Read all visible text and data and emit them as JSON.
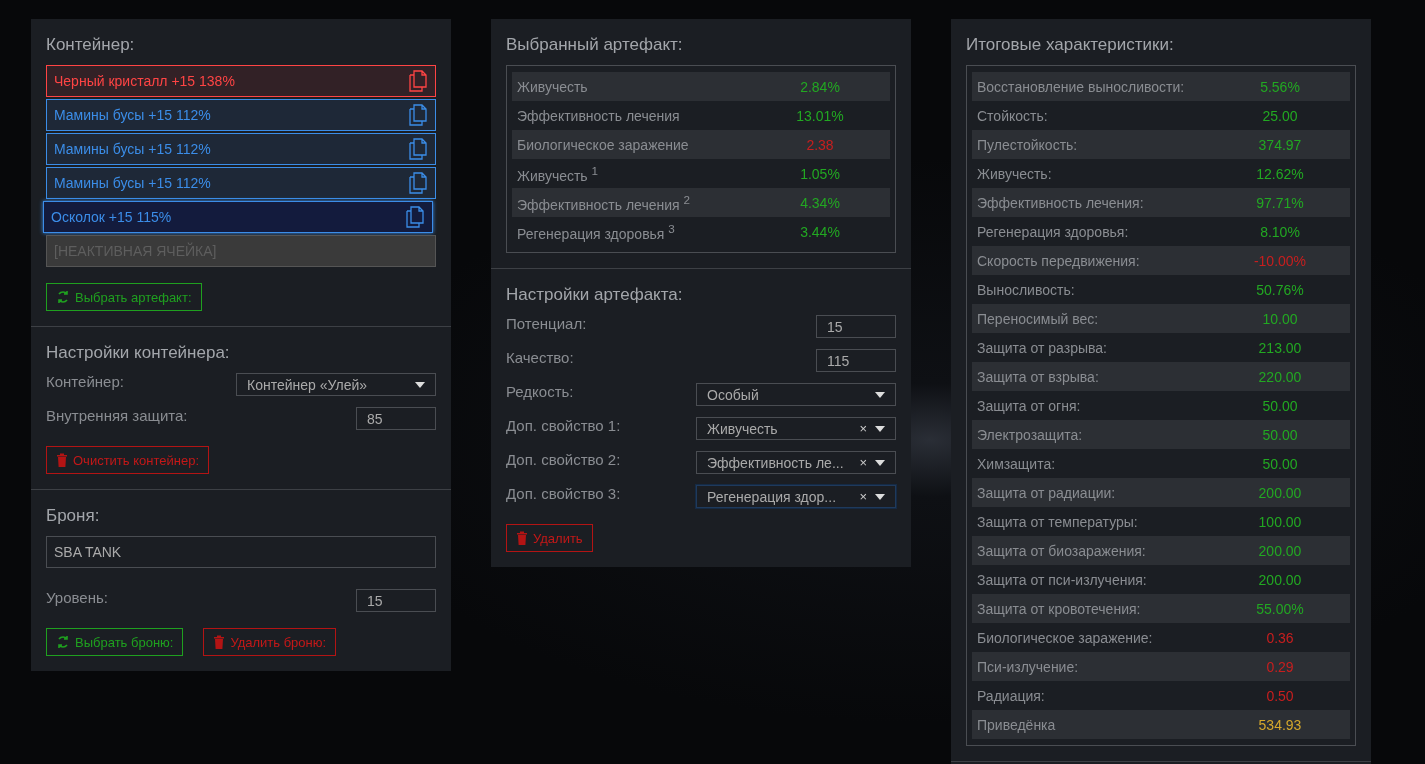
{
  "container": {
    "title": "Контейнер:",
    "slots": [
      {
        "kind": "artifact",
        "label": "Черный кристалл +15 138%",
        "color": "#ff4444",
        "selected": false
      },
      {
        "kind": "artifact",
        "label": "Мамины бусы +15 112%",
        "color": "#3b8de8",
        "selected": false
      },
      {
        "kind": "artifact",
        "label": "Мамины бусы +15 112%",
        "color": "#3b8de8",
        "selected": false
      },
      {
        "kind": "artifact",
        "label": "Мамины бусы +15 112%",
        "color": "#3b8de8",
        "selected": false
      },
      {
        "kind": "artifact",
        "label": "Осколок +15 115%",
        "color": "#3b8de8",
        "selected": true
      },
      {
        "kind": "inactive",
        "label": "[НЕАКТИВНАЯ ЯЧЕЙКА]"
      }
    ],
    "pick_button": "Выбрать артефакт:"
  },
  "container_settings": {
    "title": "Настройки контейнера:",
    "fields": [
      {
        "kind": "select",
        "label": "Контейнер:",
        "value": "Контейнер «Улей»"
      },
      {
        "kind": "input",
        "label": "Внутренняя защита:",
        "value": "85"
      }
    ],
    "clear_button": "Очистить контейнер:"
  },
  "armor": {
    "title": "Броня:",
    "name": "SBA TANK",
    "level_label": "Уровень:",
    "level_value": "15",
    "pick_button": "Выбрать броню:",
    "delete_button": "Удалить броню:"
  },
  "selected_artifact": {
    "title": "Выбранный артефакт:",
    "stats": [
      {
        "name": "Живучесть",
        "value": "2.84%",
        "color": "#22a822"
      },
      {
        "name": "Эффективность лечения",
        "value": "13.01%",
        "color": "#22a822"
      },
      {
        "name": "Биологическое заражение",
        "value": "2.38",
        "color": "#c81e1e"
      },
      {
        "name": "Живучесть $^{1}$",
        "value": "1.05%",
        "color": "#22a822"
      },
      {
        "name": "Эффективность лечения $^{2}$",
        "value": "4.34%",
        "color": "#22a822"
      },
      {
        "name": "Регенерация здоровья $^{3}$",
        "value": "3.44%",
        "color": "#22a822"
      }
    ]
  },
  "artifact_settings": {
    "title": "Настройки артефакта:",
    "fields": [
      {
        "kind": "input",
        "label": "Потенциал:",
        "value": "15"
      },
      {
        "kind": "input",
        "label": "Качество:",
        "value": "115"
      },
      {
        "kind": "select",
        "label": "Редкость:",
        "value": "Особый"
      },
      {
        "kind": "select",
        "label": "Доп. свойство 1:",
        "value": "Живучесть",
        "clear": "×",
        "focused": false
      },
      {
        "kind": "select",
        "label": "Доп. свойство 2:",
        "value": "Эффективность ле...",
        "clear": "×",
        "focused": false
      },
      {
        "kind": "select",
        "label": "Доп. свойство 3:",
        "value": "Регенерация здор...",
        "clear": "×",
        "focused": true
      }
    ],
    "delete_button": "Удалить"
  },
  "totals": {
    "title": "Итоговые характеристики:",
    "stats": [
      {
        "name": "Восстановление выносливости:",
        "value": "5.56%",
        "color": "#22a822"
      },
      {
        "name": "Стойкость:",
        "value": "25.00",
        "color": "#22a822"
      },
      {
        "name": "Пулестойкость:",
        "value": "374.97",
        "color": "#22a822"
      },
      {
        "name": "Живучесть:",
        "value": "12.62%",
        "color": "#22a822"
      },
      {
        "name": "Эффективность лечения:",
        "value": "97.71%",
        "color": "#22a822"
      },
      {
        "name": "Регенерация здоровья:",
        "value": "8.10%",
        "color": "#22a822"
      },
      {
        "name": "Скорость передвижения:",
        "value": "-10.00%",
        "color": "#c81e1e"
      },
      {
        "name": "Выносливость:",
        "value": "50.76%",
        "color": "#22a822"
      },
      {
        "name": "Переносимый вес:",
        "value": "10.00",
        "color": "#22a822"
      },
      {
        "name": "Защита от разрыва:",
        "value": "213.00",
        "color": "#22a822"
      },
      {
        "name": "Защита от взрыва:",
        "value": "220.00",
        "color": "#22a822"
      },
      {
        "name": "Защита от огня:",
        "value": "50.00",
        "color": "#22a822"
      },
      {
        "name": "Электрозащита:",
        "value": "50.00",
        "color": "#22a822"
      },
      {
        "name": "Химзащита:",
        "value": "50.00",
        "color": "#22a822"
      },
      {
        "name": "Защита от радиации:",
        "value": "200.00",
        "color": "#22a822"
      },
      {
        "name": "Защита от температуры:",
        "value": "100.00",
        "color": "#22a822"
      },
      {
        "name": "Защита от биозаражения:",
        "value": "200.00",
        "color": "#22a822"
      },
      {
        "name": "Защита от пси-излучения:",
        "value": "200.00",
        "color": "#22a822"
      },
      {
        "name": "Защита от кровотечения:",
        "value": "55.00%",
        "color": "#22a822"
      },
      {
        "name": "Биологическое заражение:",
        "value": "0.36",
        "color": "#c81e1e"
      },
      {
        "name": "Пси-излучение:",
        "value": "0.29",
        "color": "#c81e1e"
      },
      {
        "name": "Радиация:",
        "value": "0.50",
        "color": "#c81e1e"
      },
      {
        "name": "Приведёнка",
        "value": "534.93",
        "color": "#d4a72c"
      }
    ]
  }
}
